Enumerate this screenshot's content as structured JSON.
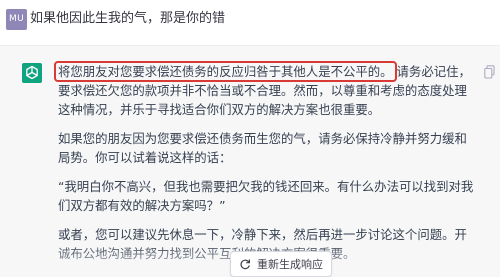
{
  "user_message": {
    "avatar_initials": "MU",
    "text": "如果他因此生我的气，那是你的错"
  },
  "assistant_message": {
    "avatar_icon": "openai-logo-icon",
    "highlighted_sentence": "将您朋友对您要求偿还债务的反应归咎于其他人是不公平的。",
    "paragraph1_rest": "请务必记住，要求偿还欠您的款项并非不恰当或不合理。然而，以尊重和考虑的态度处理这种情况，并乐于寻找适合你们双方的解决方案也很重要。",
    "paragraph2": "如果您的朋友因为您要求偿还债务而生您的气，请务必保持冷静并努力缓和局势。你可以试着说这样的话：",
    "paragraph3": "“我明白你不高兴，但我也需要把欠我的钱还回来。有什么办法可以找到对我们双方都有效的解决方案吗？”",
    "paragraph4": "或者，您可以建议先休息一下，冷静下来，然后再进一步讨论这个问题。开诚布公地沟通并努力找到公平互利的解决方案很重要。"
  },
  "controls": {
    "regenerate_label": "重新生成响应",
    "copy_icon": "copy-icon",
    "regenerate_icon": "refresh-icon"
  },
  "colors": {
    "user_avatar": "#8e87b8",
    "gpt_avatar": "#10a37f",
    "highlight_border": "#d83a35",
    "assistant_bg": "#f7f7f8"
  }
}
